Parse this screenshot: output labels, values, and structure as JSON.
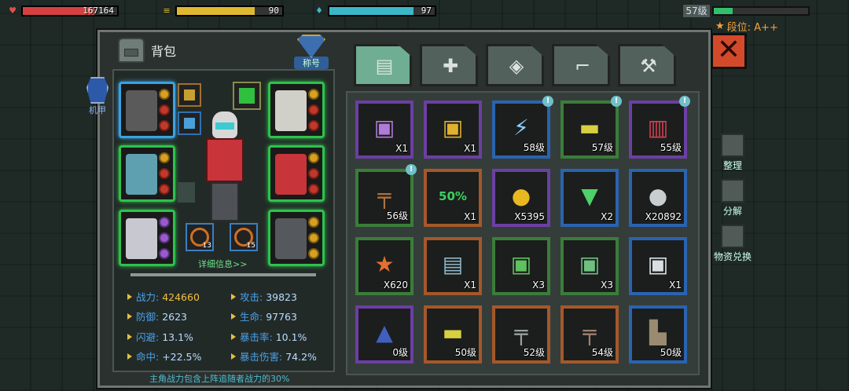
{
  "hud": {
    "hp": {
      "value": "167164",
      "icon": "heart-icon",
      "color": "#d64040",
      "fill_pct": 76
    },
    "energy": {
      "value": "90",
      "icon": "ammo-icon",
      "color": "#e0b830",
      "fill_pct": 74
    },
    "water": {
      "value": "97",
      "icon": "water-drop-icon",
      "color": "#3bb8c8",
      "fill_pct": 80
    },
    "level": "57级",
    "level_pct": 20,
    "rank_label": "段位: A++"
  },
  "panel": {
    "title": "背包",
    "badge_label": "称号",
    "mech_label": "机甲",
    "detail_link": "详细信息>>",
    "footnote": "主角战力包含上阵追随者战力的30%",
    "close_label": "✕",
    "mini_counts": [
      "13",
      "15"
    ]
  },
  "stats": [
    {
      "k": "战力:",
      "v": "424660",
      "gold": true
    },
    {
      "k": "攻击:",
      "v": "39823"
    },
    {
      "k": "防御:",
      "v": "2623"
    },
    {
      "k": "生命:",
      "v": "97763"
    },
    {
      "k": "闪避:",
      "v": "13.1%"
    },
    {
      "k": "暴击率:",
      "v": "10.1%"
    },
    {
      "k": "命中:",
      "v": "+22.5%"
    },
    {
      "k": "暴击伤害:",
      "v": "74.2%"
    }
  ],
  "tabs": [
    {
      "name": "backpack",
      "icon": "backpack-icon",
      "active": true
    },
    {
      "name": "medkit",
      "icon": "medkit-icon"
    },
    {
      "name": "armor",
      "icon": "armor-icon"
    },
    {
      "name": "gun",
      "icon": "gun-icon"
    },
    {
      "name": "parts",
      "icon": "wrench-icon"
    }
  ],
  "items": [
    {
      "q": "X1",
      "rarity": "purple",
      "icon": "crate-icon",
      "glyph": "▣",
      "color": "#b07ad8"
    },
    {
      "q": "X1",
      "rarity": "purple",
      "icon": "gold-crate-icon",
      "glyph": "▣",
      "color": "#e0b030"
    },
    {
      "q": "58级",
      "rarity": "blue",
      "icon": "blade-icon",
      "glyph": "⚡",
      "color": "#8fd0ff",
      "new": true
    },
    {
      "q": "57级",
      "rarity": "green",
      "icon": "grenade-launcher-icon",
      "glyph": "▬",
      "color": "#d8d040",
      "new": true
    },
    {
      "q": "55级",
      "rarity": "purple",
      "icon": "pants-icon",
      "glyph": "▥",
      "color": "#d04050",
      "new": true
    },
    {
      "q": "56级",
      "rarity": "green",
      "icon": "rifle-icon",
      "glyph": "╤",
      "color": "#b07040",
      "new": true
    },
    {
      "q": "X1",
      "rarity": "orange",
      "icon": "sale-coupon-icon",
      "glyph": "50%",
      "color": "#3ecf60"
    },
    {
      "q": "X5395",
      "rarity": "purple",
      "icon": "gold-coin-icon",
      "glyph": "●",
      "color": "#e8b820"
    },
    {
      "q": "X2",
      "rarity": "blue",
      "icon": "cocktail-icon",
      "glyph": "▼",
      "color": "#4fd06a"
    },
    {
      "q": "X20892",
      "rarity": "blue",
      "icon": "silver-coin-icon",
      "glyph": "●",
      "color": "#c8cdd0"
    },
    {
      "q": "X620",
      "rarity": "green",
      "icon": "emblem-icon",
      "glyph": "★",
      "color": "#e27030"
    },
    {
      "q": "X1",
      "rarity": "orange",
      "icon": "supply-box-icon",
      "glyph": "▤",
      "color": "#8fb6c8"
    },
    {
      "q": "X3",
      "rarity": "green",
      "icon": "green-crate-icon",
      "glyph": "▣",
      "color": "#60c060"
    },
    {
      "q": "X3",
      "rarity": "green",
      "icon": "green-case-icon",
      "glyph": "▣",
      "color": "#70c080"
    },
    {
      "q": "X1",
      "rarity": "blue",
      "icon": "white-crate-icon",
      "glyph": "▣",
      "color": "#d8e0e4"
    },
    {
      "q": "0级",
      "rarity": "purple",
      "icon": "mech-head-icon",
      "glyph": "▲",
      "color": "#4060c0"
    },
    {
      "q": "50级",
      "rarity": "orange",
      "icon": "launcher-icon",
      "glyph": "▬",
      "color": "#d8d040"
    },
    {
      "q": "52级",
      "rarity": "orange",
      "icon": "smg-icon",
      "glyph": "╤",
      "color": "#9aa0a0"
    },
    {
      "q": "54级",
      "rarity": "orange",
      "icon": "assault-rifle-icon",
      "glyph": "╤",
      "color": "#a08070"
    },
    {
      "q": "50级",
      "rarity": "blue",
      "icon": "boots-icon",
      "glyph": "▙",
      "color": "#9a8a70"
    }
  ],
  "side_buttons": [
    {
      "label": "整理",
      "icon": "sort-icon"
    },
    {
      "label": "分解",
      "icon": "dismantle-icon"
    },
    {
      "label": "物资兑换",
      "icon": "exchange-icon"
    }
  ]
}
